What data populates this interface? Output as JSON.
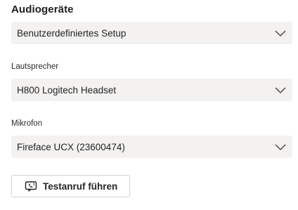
{
  "audio": {
    "title": "Audiogeräte",
    "device_setup": {
      "value": "Benutzerdefiniertes Setup",
      "icon": "chevron-down-icon"
    },
    "speaker": {
      "label": "Lautsprecher",
      "value": "H800 Logitech Headset",
      "icon": "chevron-down-icon"
    },
    "microphone": {
      "label": "Mikrofon",
      "value": "Fireface UCX (23600474)",
      "icon": "chevron-down-icon"
    },
    "test_call_button": {
      "label": "Testanruf führen",
      "icon": "call-test-icon"
    }
  },
  "colors": {
    "select_background": "#f3f2f1",
    "text": "#242424",
    "button_border": "#d1d1d1"
  }
}
